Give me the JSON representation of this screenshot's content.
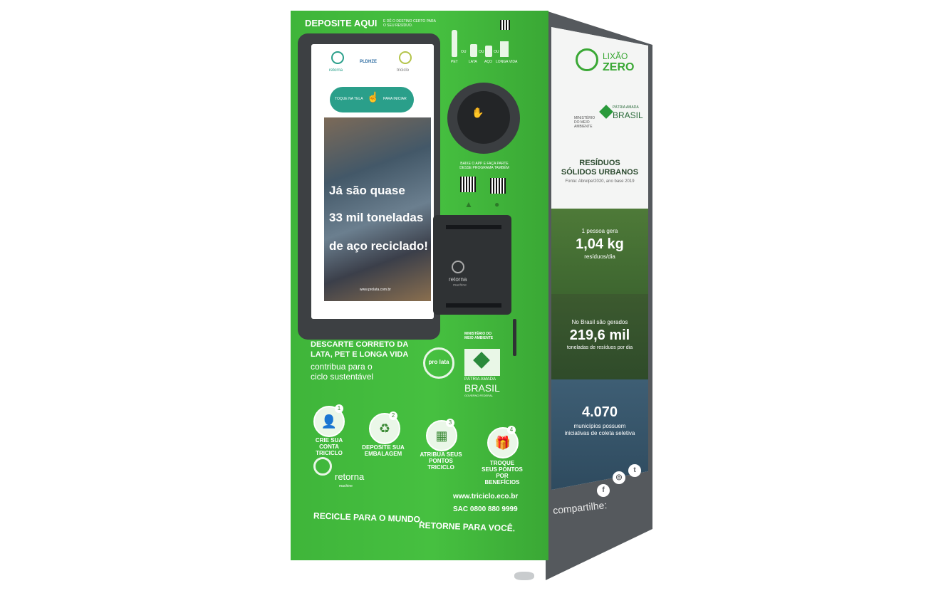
{
  "front": {
    "header_title": "DEPOSITE AQUI",
    "header_sub": "E DÊ O DESTINO CERTO PARA O SEU RESÍDUO.",
    "screen": {
      "logos": [
        "retorna",
        "PLDHZE",
        "triciclo"
      ],
      "touch_left": "TOQUE NA TELA",
      "touch_right": "PARA INICIAR",
      "headline_1": "Já são quase",
      "headline_2": "33 mil toneladas",
      "headline_3": "de aço reciclado!",
      "footer_url": "www.prolata.com.br"
    },
    "materials": [
      "PET",
      "OU",
      "LATA",
      "OU",
      "AÇO",
      "OU",
      "LONGA VIDA"
    ],
    "app_text": "BAIXE O APP E FAÇA PARTE DESSE PROGRAMA TAMBÉM",
    "dispenser_brand": "retorna",
    "dispenser_sub": "machine",
    "ministry": "MINISTÉRIO DO MEIO AMBIENTE",
    "prolata": "pro lata",
    "patria_top": "PÁTRIA AMADA",
    "patria_main": "BRASIL",
    "patria_sub": "GOVERNO FEDERAL",
    "discard_1": "DESCARTE CORRETO DA",
    "discard_2": "LATA, PET E LONGA VIDA",
    "discard_3": "contribua para o",
    "discard_4": "ciclo sustentável",
    "steps": [
      {
        "num": "1",
        "label": "CRIE SUA CONTA TRICICLO"
      },
      {
        "num": "2",
        "label": "DEPOSITE SUA EMBALAGEM"
      },
      {
        "num": "3",
        "label": "ATRIBUA SEUS PONTOS TRICICLO"
      },
      {
        "num": "4",
        "label": "TROQUE SEUS PONTOS POR BENEFÍCIOS"
      }
    ],
    "retorna_logo": "retorna",
    "retorna_sub": "machine",
    "website": "www.triciclo.eco.br",
    "sac": "SAC 0800 880 9999",
    "slogan_1": "RECICLE PARA O MUNDO.",
    "slogan_2": "RETORNE PARA VOCÊ."
  },
  "side": {
    "lixao_1": "LIXÃO",
    "lixao_2": "ZERO",
    "ministry_small": "MINISTÉRIO DO MEIO AMBIENTE",
    "brasil_top": "PÁTRIA AMADA",
    "brasil": "BRASIL",
    "section_title_1": "RESÍDUOS",
    "section_title_2": "SÓLIDOS URBANOS",
    "source": "Fonte: Abrelpe/2020, ano base 2019",
    "stat1_pre": "1 pessoa gera",
    "stat1_value": "1,04 kg",
    "stat1_post": "resíduos/dia",
    "stat2_pre": "No Brasil são gerados",
    "stat2_value": "219,6 mil",
    "stat2_post": "toneladas de resíduos por dia",
    "stat3_value": "4.070",
    "stat3_post": "municípios possuem iniciativas de coleta seletiva",
    "share": "compartilhe:",
    "social": [
      "f",
      "◎",
      "t"
    ]
  },
  "colors": {
    "front_green": "#46c040",
    "side_gray": "#55595d",
    "screen_frame": "#3d4043",
    "teal": "#2a9f8a"
  }
}
